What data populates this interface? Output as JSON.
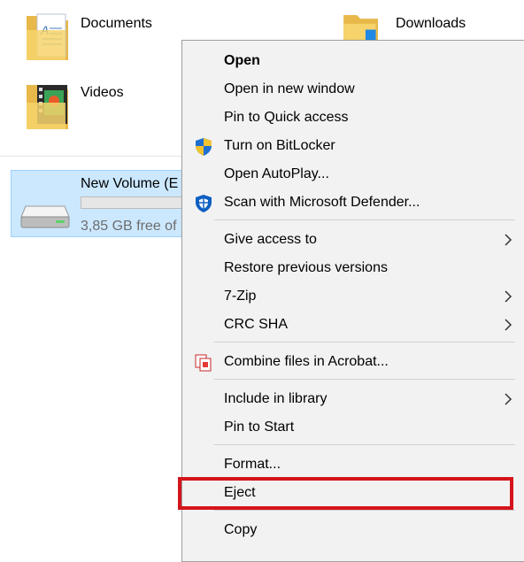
{
  "folders": {
    "documents": "Documents",
    "downloads": "Downloads",
    "videos": "Videos"
  },
  "drive": {
    "name": "New Volume (E",
    "free_text": "3,85 GB free of",
    "used_fraction": 0.0
  },
  "menu": {
    "open": "Open",
    "open_new_window": "Open in new window",
    "pin_quick_access": "Pin to Quick access",
    "bitlocker": "Turn on BitLocker",
    "autoplay": "Open AutoPlay...",
    "defender": "Scan with Microsoft Defender...",
    "give_access": "Give access to",
    "restore_versions": "Restore previous versions",
    "seven_zip": "7-Zip",
    "crc_sha": "CRC SHA",
    "combine_acrobat": "Combine files in Acrobat...",
    "include_library": "Include in library",
    "pin_start": "Pin to Start",
    "format": "Format...",
    "eject": "Eject",
    "copy": "Copy"
  },
  "icons": {
    "folder": "folder-icon",
    "drive": "drive-icon",
    "shield": "shield-icon",
    "defender": "defender-shield-icon",
    "acrobat": "acrobat-icon",
    "submenu": "chevron-right-icon"
  },
  "colors": {
    "selection_bg": "#cce8ff",
    "menu_bg": "#f2f2f2",
    "highlight": "#d4141c"
  }
}
